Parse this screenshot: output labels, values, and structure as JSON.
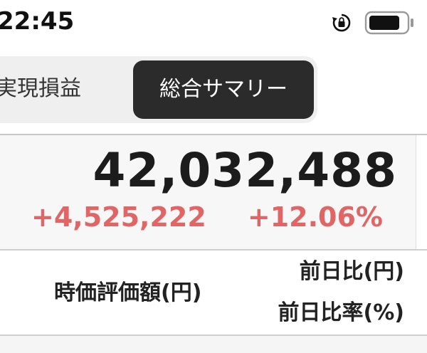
{
  "status_bar": {
    "time": "22:45",
    "icons": [
      "rotation-lock-icon",
      "battery-icon"
    ]
  },
  "tabs": {
    "items": [
      {
        "label": "実現損益",
        "selected": false
      },
      {
        "label": "総合サマリー",
        "selected": true
      }
    ],
    "selected_bg": "#2b2b2b"
  },
  "summary": {
    "total_value": "42,032,488",
    "change_amount": "+4,525,222",
    "change_percent": "+12.06%",
    "change_color": "#e06565"
  },
  "table_header": {
    "market_value": "時価評価額(円)",
    "prev_diff": "前日比(円)",
    "prev_diff_rate": "前日比率(%)"
  }
}
